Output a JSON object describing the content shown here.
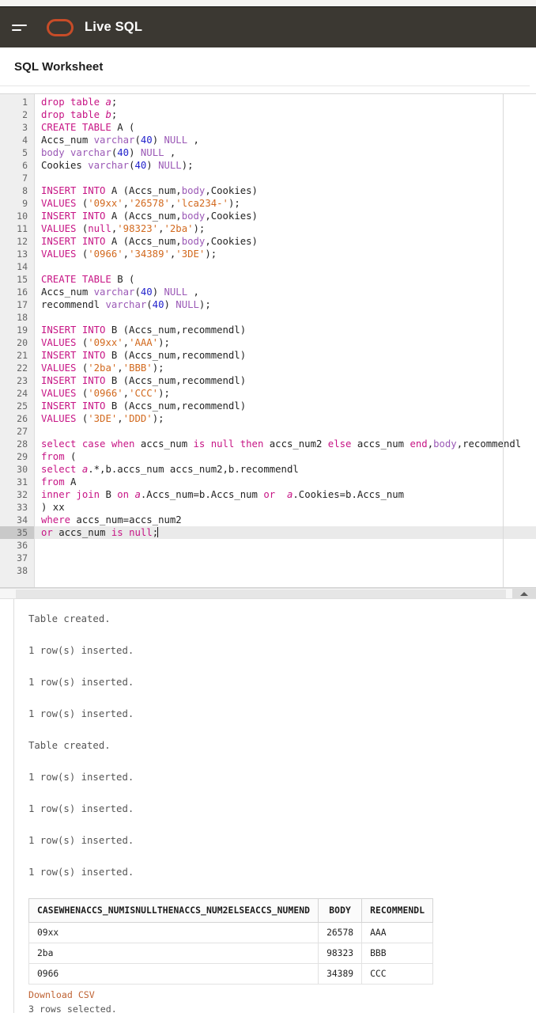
{
  "top": {
    "strip": ""
  },
  "header": {
    "menu_icon": "hamburger-menu-icon",
    "logo_icon": "oracle-logo-icon",
    "title": "Live SQL"
  },
  "page": {
    "title": "SQL Worksheet"
  },
  "editor": {
    "total_lines": 38,
    "active_line": 35,
    "lines": [
      {
        "n": 1,
        "tokens": [
          {
            "t": "drop table",
            "c": "kw"
          },
          {
            "t": " ",
            "c": "plain"
          },
          {
            "t": "a",
            "c": "kw2"
          },
          {
            "t": ";",
            "c": "plain"
          }
        ]
      },
      {
        "n": 2,
        "tokens": [
          {
            "t": "drop table",
            "c": "kw"
          },
          {
            "t": " ",
            "c": "plain"
          },
          {
            "t": "b",
            "c": "kw2"
          },
          {
            "t": ";",
            "c": "plain"
          }
        ]
      },
      {
        "n": 3,
        "tokens": [
          {
            "t": "CREATE TABLE",
            "c": "kw"
          },
          {
            "t": " A (",
            "c": "plain"
          }
        ]
      },
      {
        "n": 4,
        "tokens": [
          {
            "t": "Accs_num ",
            "c": "plain"
          },
          {
            "t": "varchar",
            "c": "typ"
          },
          {
            "t": "(",
            "c": "plain"
          },
          {
            "t": "40",
            "c": "num"
          },
          {
            "t": ") ",
            "c": "plain"
          },
          {
            "t": "NULL",
            "c": "typ"
          },
          {
            "t": " ,",
            "c": "plain"
          }
        ]
      },
      {
        "n": 5,
        "tokens": [
          {
            "t": "body",
            "c": "typ"
          },
          {
            "t": " ",
            "c": "plain"
          },
          {
            "t": "varchar",
            "c": "typ"
          },
          {
            "t": "(",
            "c": "plain"
          },
          {
            "t": "40",
            "c": "num"
          },
          {
            "t": ") ",
            "c": "plain"
          },
          {
            "t": "NULL",
            "c": "typ"
          },
          {
            "t": " ,",
            "c": "plain"
          }
        ]
      },
      {
        "n": 6,
        "tokens": [
          {
            "t": "Cookies ",
            "c": "plain"
          },
          {
            "t": "varchar",
            "c": "typ"
          },
          {
            "t": "(",
            "c": "plain"
          },
          {
            "t": "40",
            "c": "num"
          },
          {
            "t": ") ",
            "c": "plain"
          },
          {
            "t": "NULL",
            "c": "typ"
          },
          {
            "t": ");",
            "c": "plain"
          }
        ]
      },
      {
        "n": 7,
        "tokens": []
      },
      {
        "n": 8,
        "tokens": [
          {
            "t": "INSERT INTO",
            "c": "kw"
          },
          {
            "t": " A (Accs_num,",
            "c": "plain"
          },
          {
            "t": "body",
            "c": "typ"
          },
          {
            "t": ",Cookies)",
            "c": "plain"
          }
        ]
      },
      {
        "n": 9,
        "tokens": [
          {
            "t": "VALUES",
            "c": "kw"
          },
          {
            "t": " (",
            "c": "plain"
          },
          {
            "t": "'09xx'",
            "c": "str"
          },
          {
            "t": ",",
            "c": "plain"
          },
          {
            "t": "'26578'",
            "c": "str"
          },
          {
            "t": ",",
            "c": "plain"
          },
          {
            "t": "'lca234-'",
            "c": "str"
          },
          {
            "t": ");",
            "c": "plain"
          }
        ]
      },
      {
        "n": 10,
        "tokens": [
          {
            "t": "INSERT INTO",
            "c": "kw"
          },
          {
            "t": " A (Accs_num,",
            "c": "plain"
          },
          {
            "t": "body",
            "c": "typ"
          },
          {
            "t": ",Cookies)",
            "c": "plain"
          }
        ]
      },
      {
        "n": 11,
        "tokens": [
          {
            "t": "VALUES",
            "c": "kw"
          },
          {
            "t": " (",
            "c": "plain"
          },
          {
            "t": "null",
            "c": "kw"
          },
          {
            "t": ",",
            "c": "plain"
          },
          {
            "t": "'98323'",
            "c": "str"
          },
          {
            "t": ",",
            "c": "plain"
          },
          {
            "t": "'2ba'",
            "c": "str"
          },
          {
            "t": ");",
            "c": "plain"
          }
        ]
      },
      {
        "n": 12,
        "tokens": [
          {
            "t": "INSERT INTO",
            "c": "kw"
          },
          {
            "t": " A (Accs_num,",
            "c": "plain"
          },
          {
            "t": "body",
            "c": "typ"
          },
          {
            "t": ",Cookies)",
            "c": "plain"
          }
        ]
      },
      {
        "n": 13,
        "tokens": [
          {
            "t": "VALUES",
            "c": "kw"
          },
          {
            "t": " (",
            "c": "plain"
          },
          {
            "t": "'0966'",
            "c": "str"
          },
          {
            "t": ",",
            "c": "plain"
          },
          {
            "t": "'34389'",
            "c": "str"
          },
          {
            "t": ",",
            "c": "plain"
          },
          {
            "t": "'3DE'",
            "c": "str"
          },
          {
            "t": ");",
            "c": "plain"
          }
        ]
      },
      {
        "n": 14,
        "tokens": []
      },
      {
        "n": 15,
        "tokens": [
          {
            "t": "CREATE TABLE",
            "c": "kw"
          },
          {
            "t": " B (",
            "c": "plain"
          }
        ]
      },
      {
        "n": 16,
        "tokens": [
          {
            "t": "Accs_num ",
            "c": "plain"
          },
          {
            "t": "varchar",
            "c": "typ"
          },
          {
            "t": "(",
            "c": "plain"
          },
          {
            "t": "40",
            "c": "num"
          },
          {
            "t": ") ",
            "c": "plain"
          },
          {
            "t": "NULL",
            "c": "typ"
          },
          {
            "t": " ,",
            "c": "plain"
          }
        ]
      },
      {
        "n": 17,
        "tokens": [
          {
            "t": "recommendl ",
            "c": "plain"
          },
          {
            "t": "varchar",
            "c": "typ"
          },
          {
            "t": "(",
            "c": "plain"
          },
          {
            "t": "40",
            "c": "num"
          },
          {
            "t": ") ",
            "c": "plain"
          },
          {
            "t": "NULL",
            "c": "typ"
          },
          {
            "t": ");",
            "c": "plain"
          }
        ]
      },
      {
        "n": 18,
        "tokens": []
      },
      {
        "n": 19,
        "tokens": [
          {
            "t": "INSERT INTO",
            "c": "kw"
          },
          {
            "t": " B (Accs_num,recommendl)",
            "c": "plain"
          }
        ]
      },
      {
        "n": 20,
        "tokens": [
          {
            "t": "VALUES",
            "c": "kw"
          },
          {
            "t": " (",
            "c": "plain"
          },
          {
            "t": "'09xx'",
            "c": "str"
          },
          {
            "t": ",",
            "c": "plain"
          },
          {
            "t": "'AAA'",
            "c": "str"
          },
          {
            "t": ");",
            "c": "plain"
          }
        ]
      },
      {
        "n": 21,
        "tokens": [
          {
            "t": "INSERT INTO",
            "c": "kw"
          },
          {
            "t": " B (Accs_num,recommendl)",
            "c": "plain"
          }
        ]
      },
      {
        "n": 22,
        "tokens": [
          {
            "t": "VALUES",
            "c": "kw"
          },
          {
            "t": " (",
            "c": "plain"
          },
          {
            "t": "'2ba'",
            "c": "str"
          },
          {
            "t": ",",
            "c": "plain"
          },
          {
            "t": "'BBB'",
            "c": "str"
          },
          {
            "t": ");",
            "c": "plain"
          }
        ]
      },
      {
        "n": 23,
        "tokens": [
          {
            "t": "INSERT INTO",
            "c": "kw"
          },
          {
            "t": " B (Accs_num,recommendl)",
            "c": "plain"
          }
        ]
      },
      {
        "n": 24,
        "tokens": [
          {
            "t": "VALUES",
            "c": "kw"
          },
          {
            "t": " (",
            "c": "plain"
          },
          {
            "t": "'0966'",
            "c": "str"
          },
          {
            "t": ",",
            "c": "plain"
          },
          {
            "t": "'CCC'",
            "c": "str"
          },
          {
            "t": ");",
            "c": "plain"
          }
        ]
      },
      {
        "n": 25,
        "tokens": [
          {
            "t": "INSERT INTO",
            "c": "kw"
          },
          {
            "t": " B (Accs_num,recommendl)",
            "c": "plain"
          }
        ]
      },
      {
        "n": 26,
        "tokens": [
          {
            "t": "VALUES",
            "c": "kw"
          },
          {
            "t": " (",
            "c": "plain"
          },
          {
            "t": "'3DE'",
            "c": "str"
          },
          {
            "t": ",",
            "c": "plain"
          },
          {
            "t": "'DDD'",
            "c": "str"
          },
          {
            "t": ");",
            "c": "plain"
          }
        ]
      },
      {
        "n": 27,
        "tokens": []
      },
      {
        "n": 28,
        "tokens": [
          {
            "t": "select case when",
            "c": "kw"
          },
          {
            "t": " accs_num ",
            "c": "plain"
          },
          {
            "t": "is null then",
            "c": "kw"
          },
          {
            "t": " accs_num2 ",
            "c": "plain"
          },
          {
            "t": "else",
            "c": "kw"
          },
          {
            "t": " accs_num ",
            "c": "plain"
          },
          {
            "t": "end",
            "c": "kw"
          },
          {
            "t": ",",
            "c": "plain"
          },
          {
            "t": "body",
            "c": "typ"
          },
          {
            "t": ",recommendl",
            "c": "plain"
          }
        ]
      },
      {
        "n": 29,
        "tokens": [
          {
            "t": "from",
            "c": "kw"
          },
          {
            "t": " (",
            "c": "plain"
          }
        ]
      },
      {
        "n": 30,
        "tokens": [
          {
            "t": "select",
            "c": "kw"
          },
          {
            "t": " ",
            "c": "plain"
          },
          {
            "t": "a",
            "c": "kw2"
          },
          {
            "t": ".*,b.accs_num accs_num2,b.recommendl",
            "c": "plain"
          }
        ]
      },
      {
        "n": 31,
        "tokens": [
          {
            "t": "from",
            "c": "kw"
          },
          {
            "t": " A",
            "c": "plain"
          }
        ]
      },
      {
        "n": 32,
        "tokens": [
          {
            "t": "inner join",
            "c": "kw"
          },
          {
            "t": " B ",
            "c": "plain"
          },
          {
            "t": "on",
            "c": "kw"
          },
          {
            "t": " ",
            "c": "plain"
          },
          {
            "t": "a",
            "c": "kw2"
          },
          {
            "t": ".Accs_num=b.Accs_num ",
            "c": "plain"
          },
          {
            "t": "or",
            "c": "kw"
          },
          {
            "t": "  ",
            "c": "plain"
          },
          {
            "t": "a",
            "c": "kw2"
          },
          {
            "t": ".Cookies=b.Accs_num",
            "c": "plain"
          }
        ]
      },
      {
        "n": 33,
        "tokens": [
          {
            "t": ") xx",
            "c": "plain"
          }
        ]
      },
      {
        "n": 34,
        "tokens": [
          {
            "t": "where",
            "c": "kw"
          },
          {
            "t": " accs_num=accs_num2",
            "c": "plain"
          }
        ]
      },
      {
        "n": 35,
        "tokens": [
          {
            "t": "or",
            "c": "kw"
          },
          {
            "t": " accs_num ",
            "c": "plain"
          },
          {
            "t": "is null",
            "c": "kw"
          },
          {
            "t": ";",
            "c": "plain"
          }
        ],
        "caret": true
      },
      {
        "n": 36,
        "tokens": []
      },
      {
        "n": 37,
        "tokens": []
      },
      {
        "n": 38,
        "tokens": []
      }
    ]
  },
  "scrollbar": {
    "up_button_icon": "triangle-up-icon"
  },
  "output": {
    "messages": [
      "Table created.",
      "1 row(s) inserted.",
      "1 row(s) inserted.",
      "1 row(s) inserted.",
      "Table created.",
      "1 row(s) inserted.",
      "1 row(s) inserted.",
      "1 row(s) inserted.",
      "1 row(s) inserted."
    ],
    "table": {
      "columns": [
        "CASEWHENACCS_NUMISNULLTHENACCS_NUM2ELSEACCS_NUMEND",
        "BODY",
        "RECOMMENDL"
      ],
      "rows": [
        [
          "09xx",
          "26578",
          "AAA"
        ],
        [
          "2ba",
          "98323",
          "BBB"
        ],
        [
          "0966",
          "34389",
          "CCC"
        ]
      ]
    },
    "download_link": "Download CSV",
    "rows_note": "3 rows selected."
  },
  "colors": {
    "header_bg": "#3b3832",
    "brand_accent": "#c74c28",
    "keyword": "#c71585",
    "string": "#d2691e",
    "number": "#2222cc",
    "identifier": "#9b59b6",
    "link": "#bf6334"
  }
}
